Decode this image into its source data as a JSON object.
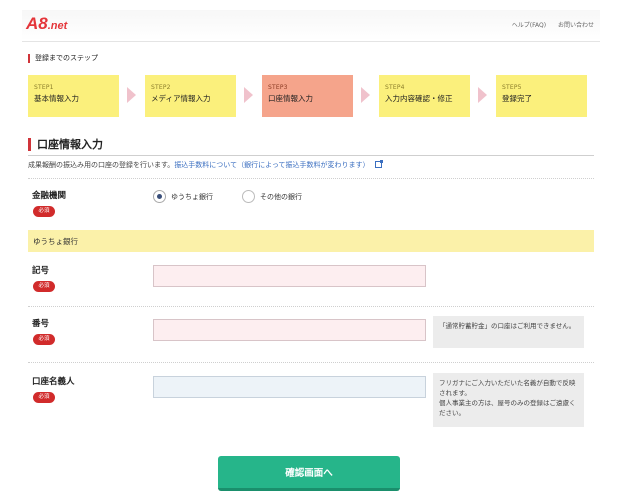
{
  "header": {
    "logo_main": "A8",
    "logo_suffix": ".net",
    "links": [
      "ヘルプ(FAQ)",
      "お問い合わせ"
    ]
  },
  "steps_section": {
    "label": "登録までのステップ",
    "steps": [
      {
        "num": "STEP1",
        "name": "基本情報入力",
        "active": false
      },
      {
        "num": "STEP2",
        "name": "メディア情報入力",
        "active": false
      },
      {
        "num": "STEP3",
        "name": "口座情報入力",
        "active": true
      },
      {
        "num": "STEP4",
        "name": "入力内容確認・修正",
        "active": false
      },
      {
        "num": "STEP5",
        "name": "登録完了",
        "active": false
      }
    ]
  },
  "main": {
    "title": "口座情報入力",
    "description": "成果報酬の振込み用の口座の登録を行います。",
    "description_link": "振込手数料について（銀行によって振込手数料が変わります）"
  },
  "form": {
    "required_badge": "必須",
    "financial_institution": {
      "label": "金融機関",
      "options": [
        "ゆうちょ銀行",
        "その他の銀行"
      ],
      "selected": "ゆうちょ銀行"
    },
    "bank_section_label": "ゆうちょ銀行",
    "symbol": {
      "label": "記号",
      "value": ""
    },
    "number": {
      "label": "番号",
      "value": "",
      "note": "「通常貯蓄貯金」の口座はご利用できません。"
    },
    "account_holder": {
      "label": "口座名義人",
      "value": "",
      "note_lines": [
        "フリガナにご入力いただいた名義が自動で反映されます。",
        "個人事業主の方は、屋号のみの登録はご遠慮ください。"
      ]
    },
    "submit_label": "確認画面へ"
  },
  "colors": {
    "accent": "#d0343a",
    "step_bg": "#fbf07c",
    "step_active_bg": "#f5a48b",
    "submit_bg": "#26b58a"
  }
}
